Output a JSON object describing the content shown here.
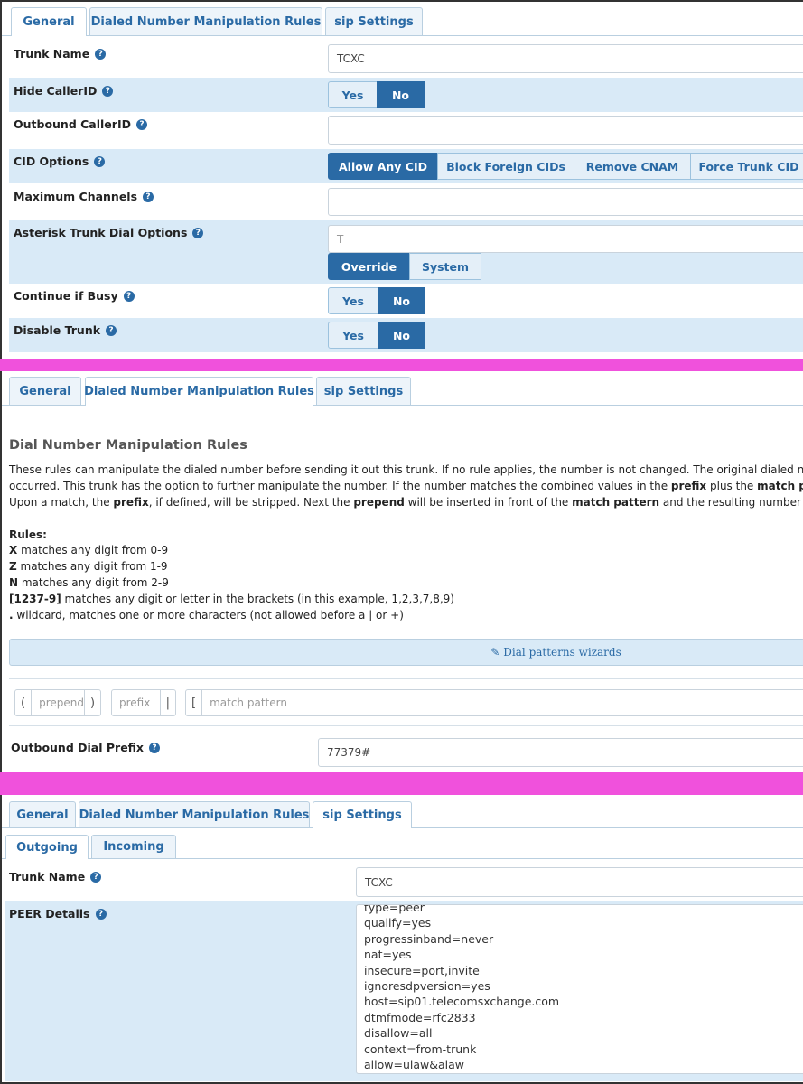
{
  "colors": {
    "accent": "#2a6aa5",
    "row_alt": "#d9eaf7",
    "separator": "#f051dc"
  },
  "panel1": {
    "tabs": [
      "General",
      "Dialed Number Manipulation Rules",
      "sip Settings"
    ],
    "trunk_name": {
      "label": "Trunk Name",
      "value": "TCXC"
    },
    "hide_callerid": {
      "label": "Hide CallerID",
      "options": [
        "Yes",
        "No"
      ],
      "selected": "No"
    },
    "outbound_callerid": {
      "label": "Outbound CallerID",
      "value": ""
    },
    "cid_options": {
      "label": "CID Options",
      "options": [
        "Allow Any CID",
        "Block Foreign CIDs",
        "Remove CNAM",
        "Force Trunk CID"
      ],
      "selected": "Allow Any CID"
    },
    "max_channels": {
      "label": "Maximum Channels",
      "value": ""
    },
    "dial_options": {
      "label": "Asterisk Trunk Dial Options",
      "placeholder": "T",
      "options": [
        "Override",
        "System"
      ],
      "selected": "Override"
    },
    "continue_busy": {
      "label": "Continue if Busy",
      "options": [
        "Yes",
        "No"
      ],
      "selected": "No"
    },
    "disable_trunk": {
      "label": "Disable Trunk",
      "options": [
        "Yes",
        "No"
      ],
      "selected": "No"
    }
  },
  "panel2": {
    "tabs": [
      "General",
      "Dialed Number Manipulation Rules",
      "sip Settings"
    ],
    "heading": "Dial Number Manipulation Rules",
    "desc": {
      "l1": "These rules can manipulate the dialed number before sending it out this trunk. If no rule applies, the number is not changed. The original dialed numb",
      "l2_a": "occurred. This trunk has the option to further manipulate the number. If the number matches the combined values in the ",
      "l2_b": "prefix",
      "l2_c": " plus the ",
      "l2_d": "match patte",
      "l3_a": "Upon a match, the ",
      "l3_b": "prefix",
      "l3_c": ", if defined, will be stripped. Next the ",
      "l3_d": "prepend",
      "l3_e": " will be inserted in front of the ",
      "l3_f": "match pattern",
      "l3_g": " and the resulting number will be"
    },
    "rules_title": "Rules:",
    "rules": [
      {
        "key": "X",
        "text": "  matches any digit from 0-9"
      },
      {
        "key": "Z",
        "text": "  matches any digit from 1-9"
      },
      {
        "key": "N",
        "text": "  matches any digit from 2-9"
      },
      {
        "key": "[1237-9]",
        "text": " matches any digit or letter in the brackets (in this example, 1,2,3,7,8,9)"
      },
      {
        "key": ".",
        "text": "  wildcard, matches one or more characters (not allowed before a | or +)"
      }
    ],
    "wizard_label": "Dial patterns wizards",
    "pattern": {
      "prepend_ph": "prepend",
      "prefix_ph": "prefix",
      "match_ph": "match pattern",
      "open_paren": "(",
      "close_paren": ")",
      "pipe": "|",
      "open_bracket": "["
    },
    "outbound_prefix": {
      "label": "Outbound Dial Prefix",
      "value": "77379#"
    }
  },
  "panel3": {
    "tabs": [
      "General",
      "Dialed Number Manipulation Rules",
      "sip Settings"
    ],
    "subtabs": [
      "Outgoing",
      "Incoming"
    ],
    "trunk_name": {
      "label": "Trunk Name",
      "value": "TCXC"
    },
    "peer_details": {
      "label": "PEER Details",
      "lines": [
        "type=peer",
        "qualify=yes",
        "progressinband=never",
        "nat=yes",
        "insecure=port,invite",
        "ignoresdpversion=yes",
        "host=sip01.telecomsxchange.com",
        "dtmfmode=rfc2833",
        "disallow=all",
        "context=from-trunk",
        "allow=ulaw&alaw"
      ]
    }
  }
}
